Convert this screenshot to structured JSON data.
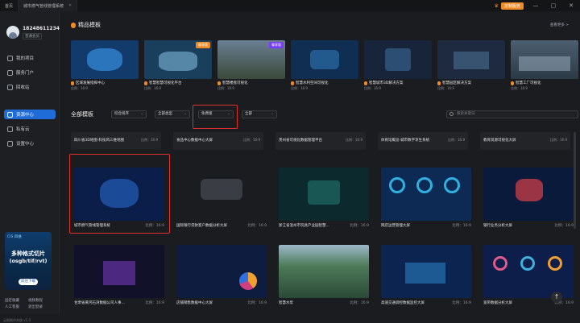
{
  "titlebar": {
    "home_tab": "首页",
    "app_tab": "城市燃气管线管理系统",
    "custom_btn": "定制服务",
    "win_controls": [
      "—",
      "▢",
      "✕"
    ]
  },
  "user": {
    "name": "18248611234",
    "badge": "普通会员"
  },
  "sidebar": {
    "items": [
      {
        "label": "我的项目"
      },
      {
        "label": "服务门户"
      },
      {
        "label": "回收站"
      },
      {
        "label": "资源中心"
      },
      {
        "label": "私有云"
      },
      {
        "label": "设置中心"
      }
    ],
    "promo": {
      "tag": "CIS 四维",
      "line1": "多种格式切片",
      "line2": "(osgb/tif/rvt)",
      "button": "前往下载"
    },
    "links": [
      "固定收藏",
      "视频教程",
      "人工客服",
      "退出登录"
    ],
    "version": "云图制作系统 v1.0"
  },
  "premium": {
    "title": "精品模板",
    "more": "查看更多 >",
    "tiles": [
      {
        "name": "区域发展指挥中心",
        "ratio": "比例：16:9",
        "badge": "",
        "bg": "#123a6b"
      },
      {
        "name": "智慧智慧可视化平台",
        "ratio": "比例：16:9",
        "badge": "尊享版",
        "bg": "#1a3f5c"
      },
      {
        "name": "智慧楼盘可视化",
        "ratio": "比例：16:9",
        "badge": "尊享版",
        "bg": "#3b4a3a"
      },
      {
        "name": "智慧水利空间可视化",
        "ratio": "比例：16:9",
        "badge": "",
        "bg": "#0f2e52"
      },
      {
        "name": "智慧城市3D解决方案",
        "ratio": "比例：16:9",
        "badge": "",
        "bg": "#18243a"
      },
      {
        "name": "智慧园区解决方案",
        "ratio": "比例：16:9",
        "badge": "",
        "bg": "#1d2a3f"
      },
      {
        "name": "智慧工厂可视化",
        "ratio": "比例：16:9",
        "badge": "",
        "bg": "#2c3a46"
      }
    ]
  },
  "all": {
    "title": "全部模板",
    "filters": [
      "综合排序",
      "全部类型",
      "免费版",
      "全部"
    ],
    "search_placeholder": "搜索关键词",
    "row1": [
      {
        "name": "四川省3D地图-科技风三维地图",
        "ratio": "比例：16:9"
      },
      {
        "name": "食品中心数据中心大屏",
        "ratio": "比例：16:9"
      },
      {
        "name": "贵州省可视化数据管理平台",
        "ratio": "比例：16:9"
      },
      {
        "name": "体育馆概览-城市数字孪生系统",
        "ratio": "比例：16:9"
      },
      {
        "name": "教育资源可视化大屏",
        "ratio": "比例：16:9"
      }
    ],
    "row2": [
      {
        "name": "城市燃气管线管理系统",
        "ratio": "比例：16:9",
        "bg": "#0b1e4a"
      },
      {
        "name": "国际银行贷款客户数据分析大屏",
        "ratio": "比例：16:9",
        "bg": "#1a1c20"
      },
      {
        "name": "浙江省温州市玩具产业园智慧...",
        "ratio": "比例：16:9",
        "bg": "#0c2a2e"
      },
      {
        "name": "网店运营管理大屏",
        "ratio": "比例：16:9",
        "bg": "#0d2a55"
      },
      {
        "name": "银行业务分析大屏",
        "ratio": "比例：16:9",
        "bg": "#0a1a3a"
      }
    ],
    "row3": [
      {
        "name": "甘肃省黄河石湾数据公司人事...",
        "ratio": "比例：16:9",
        "bg": "#11112a"
      },
      {
        "name": "店铺销售数据中心大屏",
        "ratio": "比例：16:9",
        "bg": "#0e1d3f"
      },
      {
        "name": "智慧水泵",
        "ratio": "比例：16:9",
        "bg": "#2b4a38"
      },
      {
        "name": "高速交通调控数据监控大屏",
        "ratio": "比例：16:9",
        "bg": "#0b2550"
      },
      {
        "name": "宽带数据分析大屏",
        "ratio": "比例：16:9",
        "bg": "#0d1e4a"
      }
    ]
  },
  "colors": {
    "accent": "#1f6bd8",
    "brand_orange": "#f08a24",
    "highlight": "#e0302b"
  }
}
